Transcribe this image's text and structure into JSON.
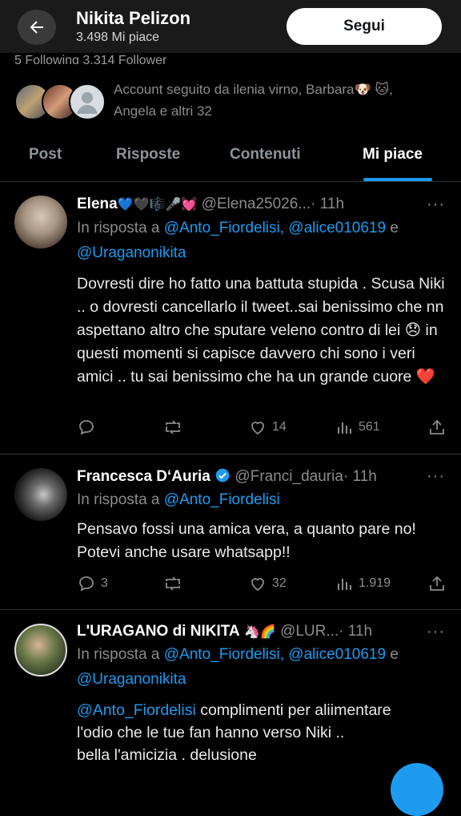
{
  "header": {
    "back_icon": "arrow-left-icon",
    "name": "Nikita Pelizon",
    "likes": "3.498 Mi piace",
    "follow_label": "Segui",
    "cut_stats": "5 Following   3.314 Follower"
  },
  "followed_by": {
    "text": "Account seguito da ilenia virno, Barbara🐶 🐱, Angela e altri 32"
  },
  "tabs": [
    "Post",
    "Risposte",
    "Contenuti",
    "Mi piace"
  ],
  "active_tab": "Mi piace",
  "tweets": [
    {
      "name": "Elena",
      "name_emojis": "💙🖤🎼🎤💓",
      "handle": "@Elena25026...",
      "time": "· 11h",
      "reply_prefix": "In risposta a ",
      "reply_mentions_1": "@Anto_Fiordelisi, @alice010619",
      "reply_and": " e",
      "reply_mentions_2": "@Uraganonikita",
      "body": "Dovresti dire ho fatto una battuta stupida . Scusa Niki .. o dovresti cancellarlo il tweet..sai benissimo che nn aspettano altro che sputare veleno contro di lei 😞 in questi momenti si capisce davvero chi sono i veri amici .. tu sai benissimo che ha un grande cuore ❤️",
      "replies": "",
      "reposts": "",
      "likes": "14",
      "views": "561"
    },
    {
      "name": "Francesca D‘Auria",
      "handle": "@Franci_dauria",
      "time": "· 11h",
      "reply_prefix": "In risposta a ",
      "reply_mentions_1": "@Anto_Fiordelisi",
      "body": "Pensavo fossi una amica vera, a quanto pare no! Potevi anche usare whatsapp!!",
      "replies": "3",
      "reposts": "",
      "likes": "32",
      "views": "1.919"
    },
    {
      "name": "L'URAGANO di NIKITA",
      "name_emojis": "🦄🌈",
      "handle": "@LUR...",
      "time": "· 11h",
      "reply_prefix": "In risposta a ",
      "reply_mentions_1": "@Anto_Fiordelisi, @alice010619",
      "reply_and": " e",
      "reply_mentions_2": "@Uraganonikita",
      "body_mention": "@Anto_Fiordelisi",
      "body_line1": " complimenti per aliimentare",
      "body_line2": "l'odio  che le tue fan hanno verso Niki ..",
      "body_line3": "bella l'amicizia . delusione"
    }
  ],
  "colors": {
    "accent": "#1d9bf0",
    "background": "#000000",
    "muted": "#8b8b8b"
  }
}
